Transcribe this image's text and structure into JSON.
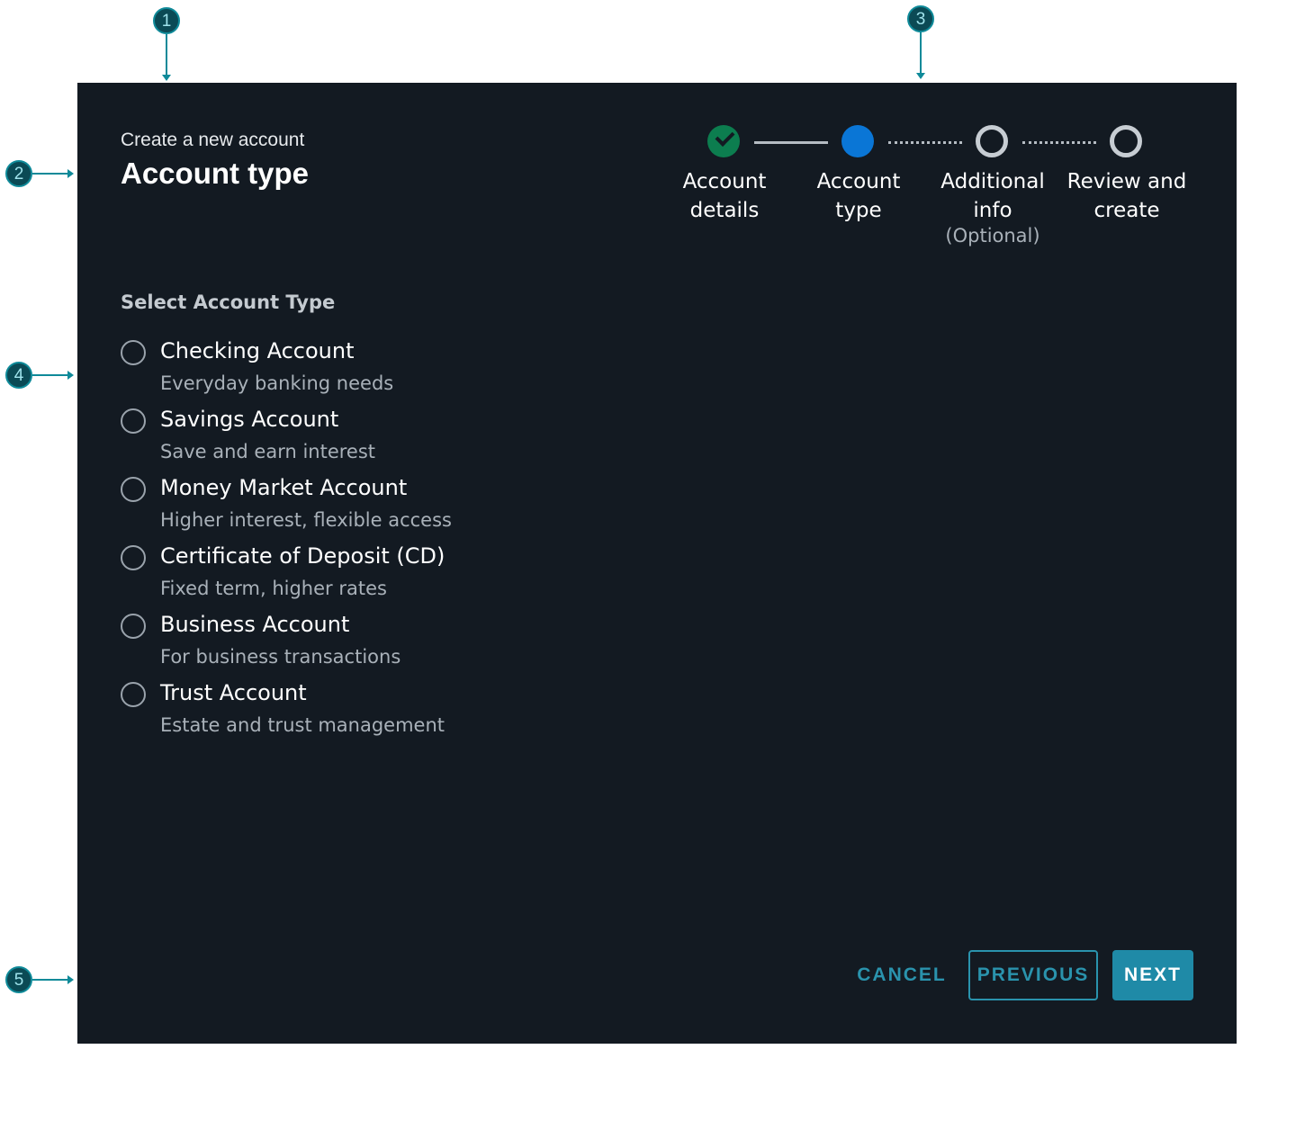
{
  "annotations": [
    "1",
    "2",
    "3",
    "4",
    "5"
  ],
  "header": {
    "subtitle": "Create a new account",
    "title": "Account type"
  },
  "stepper": {
    "steps": [
      {
        "label": "Account details",
        "state": "complete",
        "note": ""
      },
      {
        "label": "Account type",
        "state": "current",
        "note": ""
      },
      {
        "label": "Additional info",
        "state": "upcoming",
        "note": "(Optional)"
      },
      {
        "label": "Review and create",
        "state": "upcoming",
        "note": ""
      }
    ]
  },
  "form": {
    "section_label": "Select Account Type",
    "options": [
      {
        "title": "Checking Account",
        "description": "Everyday banking needs",
        "selected": false
      },
      {
        "title": "Savings Account",
        "description": "Save and earn interest",
        "selected": false
      },
      {
        "title": "Money Market Account",
        "description": "Higher interest, flexible access",
        "selected": false
      },
      {
        "title": "Certificate of Deposit (CD)",
        "description": "Fixed term, higher rates",
        "selected": false
      },
      {
        "title": "Business Account",
        "description": "For business transactions",
        "selected": false
      },
      {
        "title": "Trust Account",
        "description": "Estate and trust management",
        "selected": false
      }
    ]
  },
  "footer": {
    "cancel_label": "CANCEL",
    "previous_label": "PREVIOUS",
    "next_label": "NEXT"
  },
  "colors": {
    "background": "#131a22",
    "complete": "#0c7d4f",
    "current": "#0a76d6",
    "accent": "#1f8aa7",
    "annotation": "#0b4a55"
  }
}
